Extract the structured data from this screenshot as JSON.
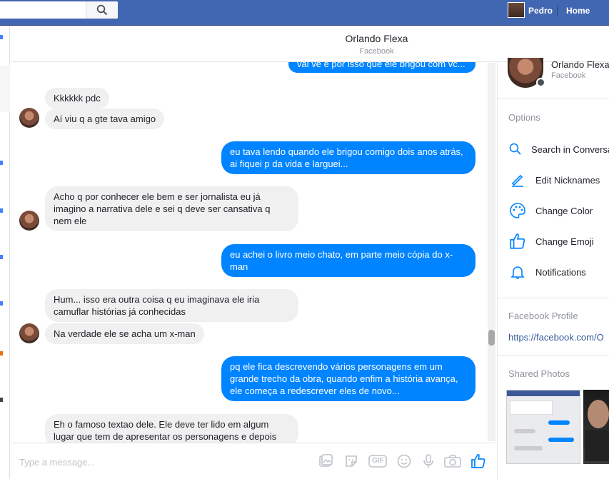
{
  "topbar": {
    "user_name": "Pedro",
    "home_label": "Home",
    "colors": {
      "bar": "#4267b2"
    }
  },
  "header": {
    "contact_name": "Orlando Flexa",
    "contact_sub": "Facebook"
  },
  "messages": [
    {
      "dir": "out",
      "text": "vai vê é por isso que ele brigou com vc..."
    },
    {
      "dir": "in",
      "text": "Kkkkkk pdc"
    },
    {
      "dir": "in",
      "text": "Aí viu q a gte tava amigo"
    },
    {
      "dir": "out",
      "text": "eu tava lendo quando ele brigou comigo dois anos atrás, ai fiquei p da vida e larguei..."
    },
    {
      "dir": "in",
      "text": "Acho q por conhecer ele bem e ser jornalista eu já imagino a narrativa dele e sei q deve ser cansativa q nem ele"
    },
    {
      "dir": "out",
      "text": "eu achei o livro meio chato, em parte meio cópia do x-man"
    },
    {
      "dir": "in",
      "text": "Hum... isso era outra coisa q eu imaginava ele iria camuflar histórias já conhecidas"
    },
    {
      "dir": "in",
      "text": "Na verdade ele se acha um x-man"
    },
    {
      "dir": "out",
      "text": "pq ele fica descrevendo vários personagens em um grande trecho da obra, quando enfim a história avança, ele começa a redescrever eles de novo..."
    },
    {
      "dir": "in",
      "text": "Eh o famoso textao dele. Ele deve ter lido em algum lugar que tem de apresentar os personagens e depois"
    }
  ],
  "composer": {
    "placeholder": "Type a message...",
    "icons": [
      "image-icon",
      "sticker-icon",
      "gif-icon",
      "emoji-icon",
      "microphone-icon",
      "camera-icon",
      "like-icon"
    ],
    "gif_label": "GIF"
  },
  "right_panel": {
    "name": "Orlando Flexa",
    "sub": "Facebook",
    "options_heading": "Options",
    "options": [
      {
        "icon": "search-icon",
        "label": "Search in Conversation"
      },
      {
        "icon": "pencil-icon",
        "label": "Edit Nicknames"
      },
      {
        "icon": "palette-icon",
        "label": "Change Color"
      },
      {
        "icon": "thumbs-up-icon",
        "label": "Change Emoji"
      },
      {
        "icon": "bell-icon",
        "label": "Notifications"
      }
    ],
    "profile_heading": "Facebook Profile",
    "profile_link": "https://facebook.com/O",
    "photos_heading": "Shared Photos"
  },
  "colors": {
    "accent": "#0084ff",
    "incoming": "#f1f0f0"
  }
}
